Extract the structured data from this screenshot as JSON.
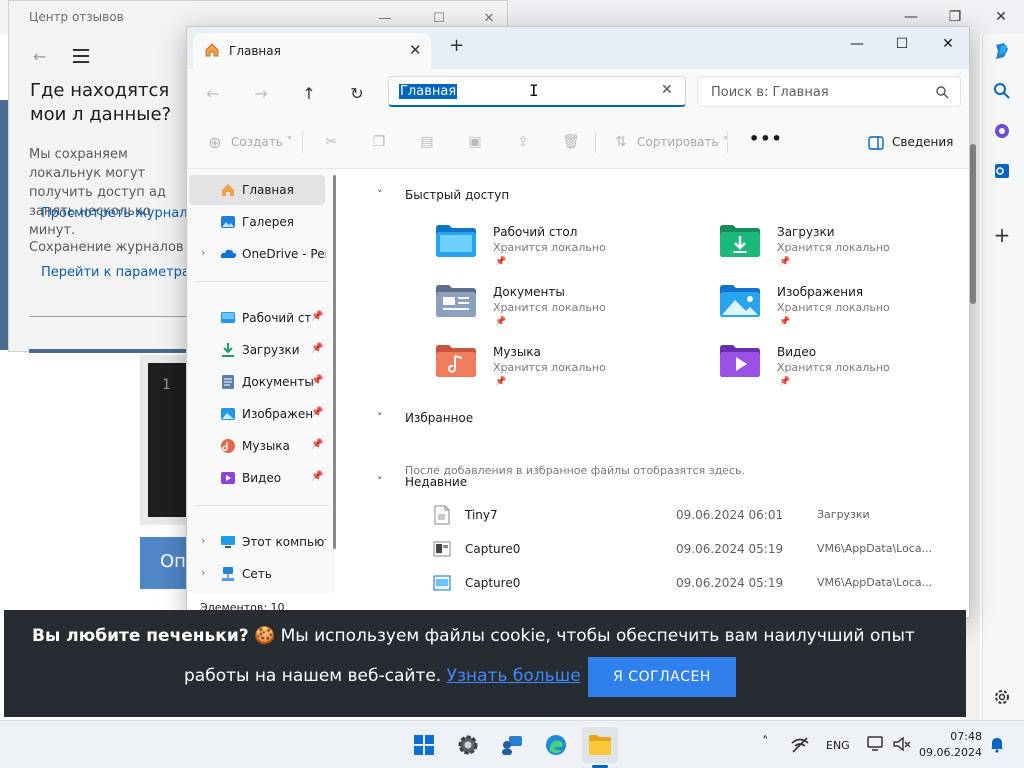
{
  "feedback_hub": {
    "title": "Центр отзывов",
    "heading": "Где находятся мои л данные?",
    "text1": "Мы сохраняем локальнук могут получить доступ ад занять несколько минут.",
    "link1": "Просмотреть журналы д",
    "text2": "Сохранение журналов ди",
    "link2": "Перейти к параметрам"
  },
  "browser": {
    "code_line_number": "1",
    "button_partial": "Опі"
  },
  "explorer": {
    "tab_title": "Главная",
    "address_value": "Главная",
    "search_placeholder": "Поиск в: Главная",
    "toolbar": {
      "create": "Создать",
      "sort": "Сортировать",
      "more": "•••",
      "details": "Сведения"
    },
    "nav_items": [
      {
        "label": "Главная",
        "icon": "home-icon",
        "selected": true
      },
      {
        "label": "Галерея",
        "icon": "gallery-icon"
      },
      {
        "label": "OneDrive - Personal",
        "icon": "onedrive-icon"
      },
      {
        "label": "Рабочий стол",
        "icon": "desktop-icon"
      },
      {
        "label": "Загрузки",
        "icon": "downloads-icon"
      },
      {
        "label": "Документы",
        "icon": "documents-icon"
      },
      {
        "label": "Изображения",
        "icon": "pictures-icon"
      },
      {
        "label": "Музыка",
        "icon": "music-icon"
      },
      {
        "label": "Видео",
        "icon": "videos-icon"
      },
      {
        "label": "Этот компьютер",
        "icon": "this-pc-icon"
      },
      {
        "label": "Сеть",
        "icon": "network-icon"
      }
    ],
    "status": "Элементов: 10",
    "sections": {
      "quick_access": "Быстрый доступ",
      "favorites": "Избранное",
      "recent": "Недавние"
    },
    "quick_access": [
      {
        "name": "Рабочий стол",
        "sub": "Хранится локально",
        "icon": "desktop-folder-icon"
      },
      {
        "name": "Загрузки",
        "sub": "Хранится локально",
        "icon": "downloads-folder-icon"
      },
      {
        "name": "Документы",
        "sub": "Хранится локально",
        "icon": "documents-folder-icon"
      },
      {
        "name": "Изображения",
        "sub": "Хранится локально",
        "icon": "pictures-folder-icon"
      },
      {
        "name": "Музыка",
        "sub": "Хранится локально",
        "icon": "music-folder-icon"
      },
      {
        "name": "Видео",
        "sub": "Хранится локально",
        "icon": "videos-folder-icon"
      }
    ],
    "favorites_note": "После добавления в избранное файлы отобразятся здесь.",
    "recent": [
      {
        "name": "Tiny7",
        "date": "09.06.2024 06:01",
        "location": "Загрузки"
      },
      {
        "name": "Capture0",
        "date": "09.06.2024 05:19",
        "location": "VM6\\AppData\\Loca..."
      },
      {
        "name": "Capture0",
        "date": "09.06.2024 05:19",
        "location": "VM6\\AppData\\Loca..."
      }
    ]
  },
  "cookie": {
    "bold": "Вы любите печеньки?",
    "emoji": "🍪",
    "text1": " Мы используем файлы cookie, чтобы обеспечить вам наилучший опыт",
    "text2": "работы на нашем веб-сайте. ",
    "link": "Узнать больше",
    "button": "Я СОГЛАСЕН"
  },
  "taskbar": {
    "language": "ENG",
    "time": "07:48",
    "date": "09.06.2024"
  },
  "colors": {
    "accent": "#0067c0",
    "cookie_bg": "#272c33",
    "cookie_button": "#2f80ed"
  }
}
